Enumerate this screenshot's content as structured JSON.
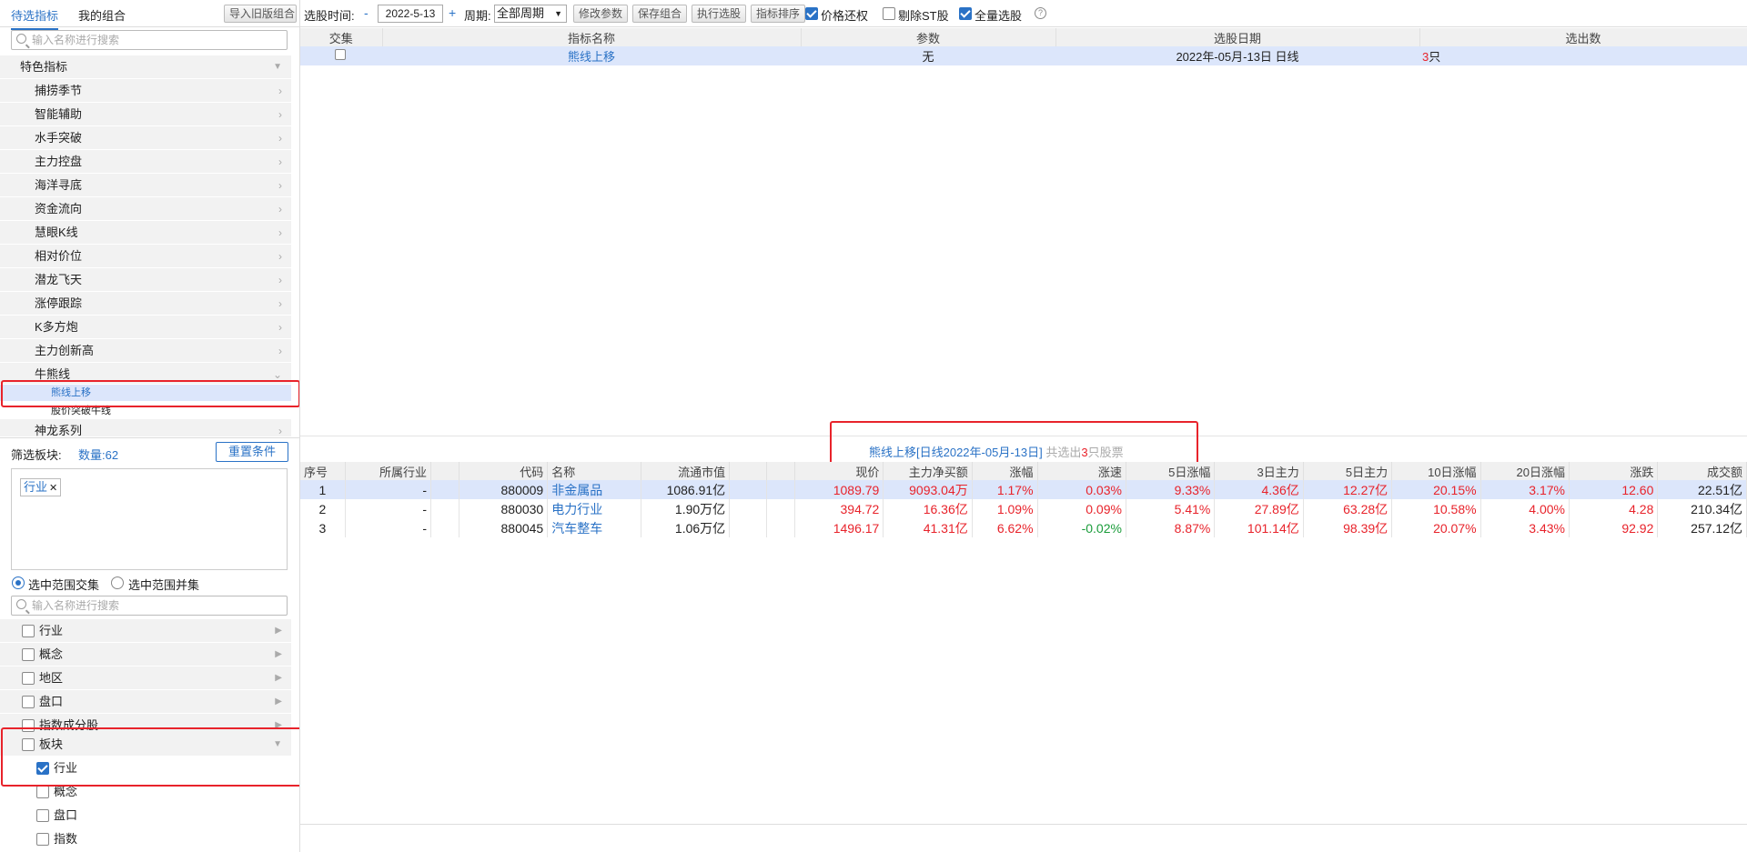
{
  "left": {
    "tabs": [
      "待选指标",
      "我的组合"
    ],
    "import_button": "导入旧版组合",
    "search_placeholder": "输入名称进行搜索",
    "tree_header": "特色指标",
    "tree_items": [
      "捕捞季节",
      "智能辅助",
      "水手突破",
      "主力控盘",
      "海洋寻底",
      "资金流向",
      "慧眼K线",
      "相对价位",
      "潜龙飞天",
      "涨停跟踪",
      "K多方炮",
      "主力创新高",
      "牛熊线"
    ],
    "sub_items": [
      "熊线上移",
      "股价突破牛线"
    ],
    "last_item": "神龙系列",
    "filter": {
      "label": "筛选板块:",
      "count": "数量:62",
      "reset_button": "重置条件",
      "tag": "行业",
      "tag_close": "✕",
      "radio_intersect": "选中范围交集",
      "radio_union": "选中范围并集",
      "search_placeholder": "输入名称进行搜索"
    },
    "groups": [
      "行业",
      "概念",
      "地区",
      "盘口",
      "指数成分股"
    ],
    "board_group": "板块",
    "board_children": [
      "行业",
      "概念",
      "盘口",
      "指数"
    ]
  },
  "toolbar": {
    "time_label": "选股时间:",
    "minus": "-",
    "date_value": "2022-5-13",
    "plus": "+",
    "period_label": "周期:",
    "period_value": "全部周期",
    "buttons": [
      "修改参数",
      "保存组合",
      "执行选股",
      "指标排序"
    ],
    "checks": [
      "价格还权",
      "剔除ST股",
      "全量选股"
    ],
    "help": "?"
  },
  "indicator_table": {
    "headers": [
      "交集",
      "指标名称",
      "参数",
      "选股日期",
      "选出数"
    ],
    "row": {
      "name": "熊线上移",
      "param": "无",
      "date": "2022年-05月-13日 日线",
      "count_num": "3",
      "count_unit": "只"
    }
  },
  "result": {
    "title_link": "熊线上移[日线2022年-05月-13日]",
    "title_mid": " 共选出",
    "title_num": "3",
    "title_tail": "只股票",
    "headers": [
      "序号",
      "所属行业",
      "",
      "代码",
      "名称",
      "流通市值",
      "",
      "",
      "现价",
      "主力净买额",
      "涨幅",
      "涨速",
      "5日涨幅",
      "3日主力",
      "5日主力",
      "10日涨幅",
      "20日涨幅",
      "涨跌",
      "成交额"
    ],
    "rows": [
      {
        "idx": "1",
        "industry": "-",
        "code": "880009",
        "name": "非金属品",
        "mcap": "1086.91亿",
        "price": "1089.79",
        "net": "9093.04万",
        "chg": "1.17%",
        "speed": "0.03%",
        "chg5": "9.33%",
        "main3": "4.36亿",
        "main5": "12.27亿",
        "chg10": "20.15%",
        "chg20": "3.17%",
        "diff": "12.60",
        "amount": "22.51亿"
      },
      {
        "idx": "2",
        "industry": "-",
        "code": "880030",
        "name": "电力行业",
        "mcap": "1.90万亿",
        "price": "394.72",
        "net": "16.36亿",
        "chg": "1.09%",
        "speed": "0.09%",
        "chg5": "5.41%",
        "main3": "27.89亿",
        "main5": "63.28亿",
        "chg10": "10.58%",
        "chg20": "4.00%",
        "diff": "4.28",
        "amount": "210.34亿"
      },
      {
        "idx": "3",
        "industry": "-",
        "code": "880045",
        "name": "汽车整车",
        "mcap": "1.06万亿",
        "price": "1496.17",
        "net": "41.31亿",
        "chg": "6.62%",
        "speed": "-0.02%",
        "chg5": "8.87%",
        "main3": "101.14亿",
        "main5": "98.39亿",
        "chg10": "20.07%",
        "chg20": "3.43%",
        "diff": "92.92",
        "amount": "257.12亿"
      }
    ]
  },
  "colors": {
    "accent": "#2a72c6",
    "up": "#e8232b",
    "down": "#1a9c3a",
    "highlight": "#dce6fb",
    "annotation": "#e8232b"
  }
}
